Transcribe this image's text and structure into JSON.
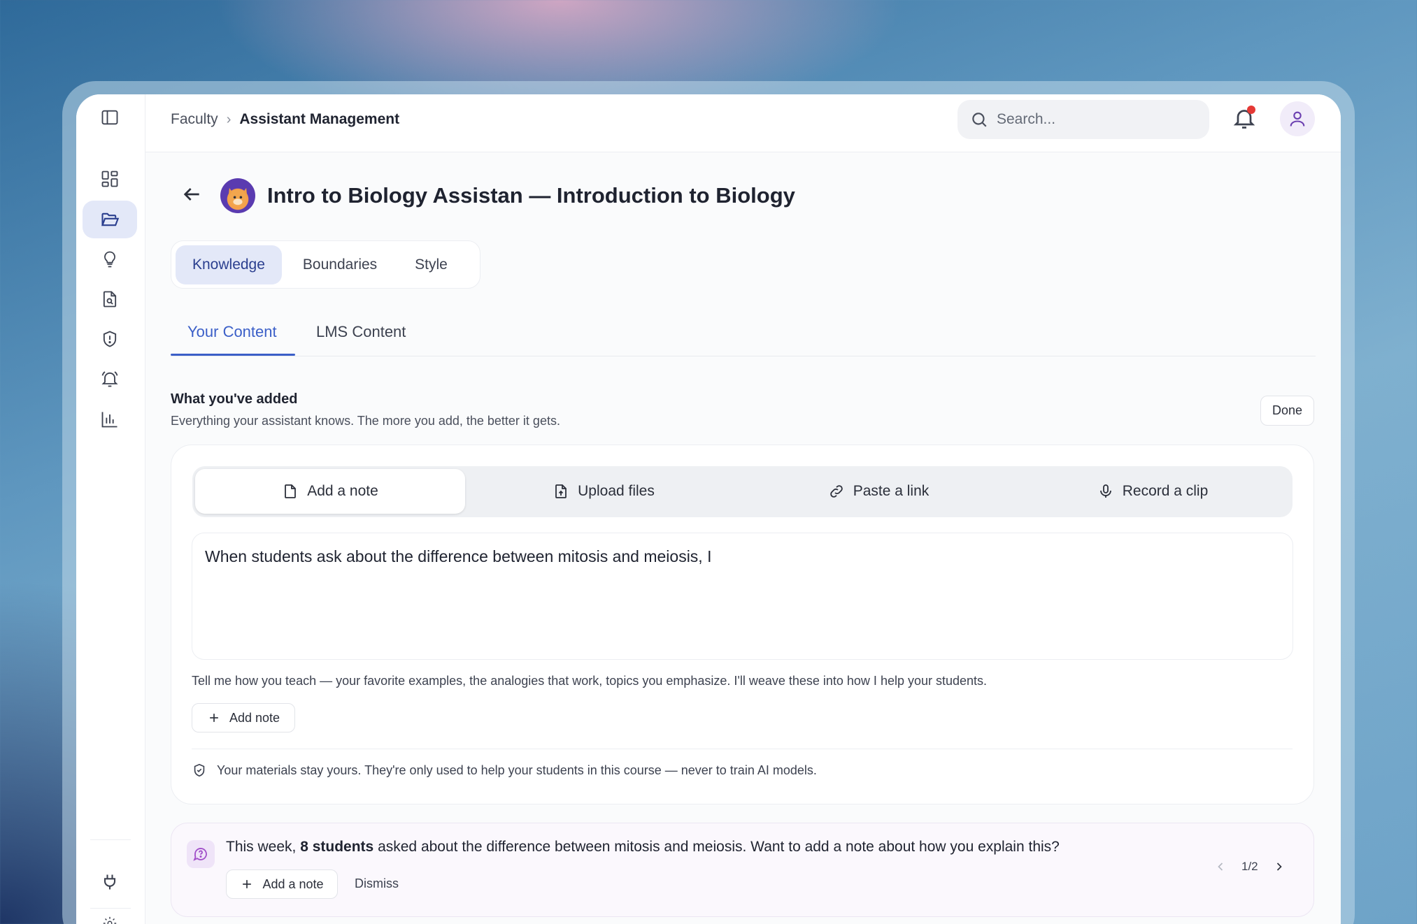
{
  "header": {
    "breadcrumb": [
      "Faculty",
      "Assistant Management"
    ],
    "search_placeholder": "Search...",
    "notification_dot_color": "#e53935"
  },
  "sidebar": {
    "items": [
      {
        "name": "dashboard",
        "icon": "grid-icon",
        "active": false
      },
      {
        "name": "assistants",
        "icon": "folder-open-icon",
        "active": true
      },
      {
        "name": "insights",
        "icon": "lightbulb-icon",
        "active": false
      },
      {
        "name": "documents",
        "icon": "file-search-icon",
        "active": false
      },
      {
        "name": "boundaries",
        "icon": "shield-alert-icon",
        "active": false
      },
      {
        "name": "alerts",
        "icon": "bell-ring-icon",
        "active": false
      },
      {
        "name": "analytics",
        "icon": "bar-chart-icon",
        "active": false
      },
      {
        "name": "integrations",
        "icon": "plug-icon",
        "active": false
      },
      {
        "name": "settings",
        "icon": "gear-icon",
        "active": false
      }
    ]
  },
  "page": {
    "title": "Intro to Biology Assistan — Introduction to Biology",
    "tabs": [
      {
        "label": "Knowledge",
        "active": true
      },
      {
        "label": "Boundaries",
        "active": false
      },
      {
        "label": "Style",
        "active": false
      }
    ],
    "sub_tabs": [
      {
        "label": "Your Content",
        "active": true
      },
      {
        "label": "LMS Content",
        "active": false
      }
    ]
  },
  "section": {
    "title": "What you've added",
    "subtitle": "Everything your assistant knows. The more you add, the better it gets.",
    "done_label": "Done"
  },
  "content_card": {
    "modes": [
      {
        "label": "Add a note",
        "icon": "file-icon",
        "active": true
      },
      {
        "label": "Upload files",
        "icon": "file-upload-icon",
        "active": false
      },
      {
        "label": "Paste a link",
        "icon": "link-icon",
        "active": false
      },
      {
        "label": "Record a clip",
        "icon": "microphone-icon",
        "active": false
      }
    ],
    "note_value": "When students ask about the difference between mitosis and meiosis, I",
    "hint": "Tell me how you teach — your favorite examples, the analogies that work, topics you emphasize. I'll weave these into how I help your students.",
    "add_note_label": "Add note",
    "privacy_text": "Your materials stay yours. They're only used to help your students in this course — never to train AI models."
  },
  "insight": {
    "text_prefix": "This week, ",
    "text_bold": "8 students",
    "text_suffix": " asked about the difference between mitosis and meiosis. Want to add a note about how you explain this?",
    "add_label": "Add a note",
    "dismiss_label": "Dismiss",
    "pager": "1/2"
  },
  "colors": {
    "accent": "#3b5fc8",
    "active_tab_bg": "#e3e8f8",
    "insight_accent": "#a14fc9"
  }
}
